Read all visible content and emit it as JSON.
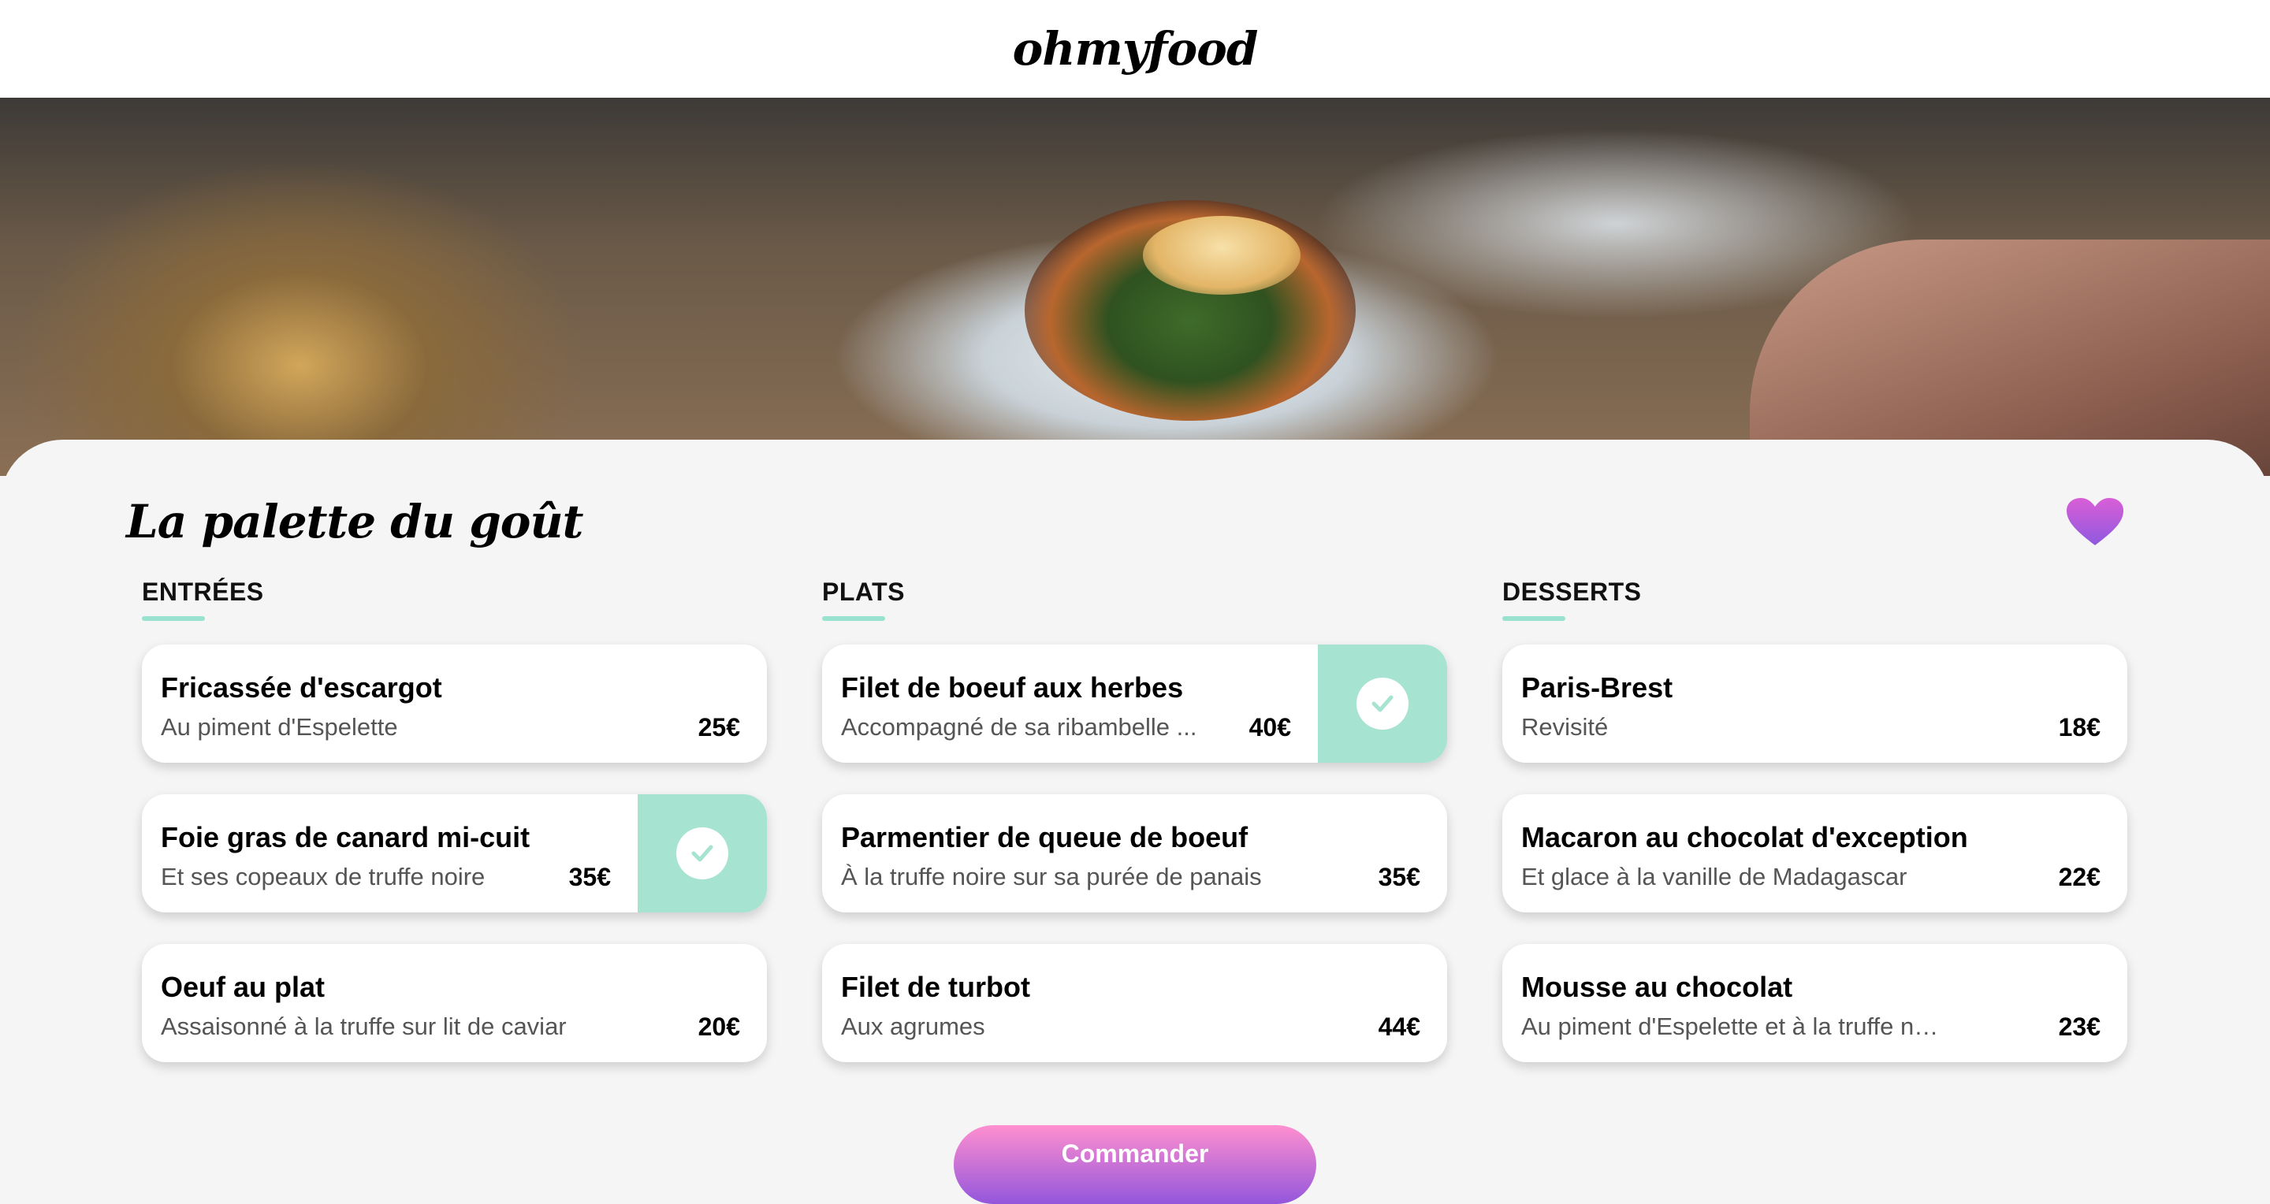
{
  "header": {
    "logo": "ohmyfood"
  },
  "restaurant": {
    "title": "La palette du goût"
  },
  "colors": {
    "accent_mint": "#99e2d0",
    "button_gradient_top": "#ff8fcf",
    "button_gradient_bottom": "#9356dc",
    "heart_top": "#d95ed6",
    "heart_bottom": "#8f59e0"
  },
  "sections": [
    {
      "title": "ENTRÉES",
      "items": [
        {
          "name": "Fricassée d'escargot",
          "description": "Au piment d'Espelette",
          "price": "25€"
        },
        {
          "name": "Foie gras de canard mi-cuit",
          "description": "Et ses copeaux de truffe noire",
          "price": "35€"
        },
        {
          "name": "Oeuf au plat",
          "description": "Assaisonné à la truffe sur lit de caviar",
          "price": "20€"
        }
      ]
    },
    {
      "title": "PLATS",
      "items": [
        {
          "name": "Filet de boeuf aux herbes",
          "description": "Accompagné de sa ribambelle ...",
          "price": "40€"
        },
        {
          "name": "Parmentier de queue de boeuf",
          "description": "À la truffe noire sur sa purée de panais",
          "price": "35€"
        },
        {
          "name": "Filet de turbot",
          "description": "Aux agrumes",
          "price": "44€"
        }
      ]
    },
    {
      "title": "DESSERTS",
      "items": [
        {
          "name": "Paris-Brest",
          "description": "Revisité",
          "price": "18€"
        },
        {
          "name": "Macaron au chocolat d'exception",
          "description": "Et glace à la vanille de Madagascar",
          "price": "22€"
        },
        {
          "name": "Mousse au chocolat",
          "description": "Au piment d'Espelette et à la truffe noire",
          "price": "23€"
        }
      ]
    }
  ],
  "order_button": {
    "label": "Commander"
  }
}
